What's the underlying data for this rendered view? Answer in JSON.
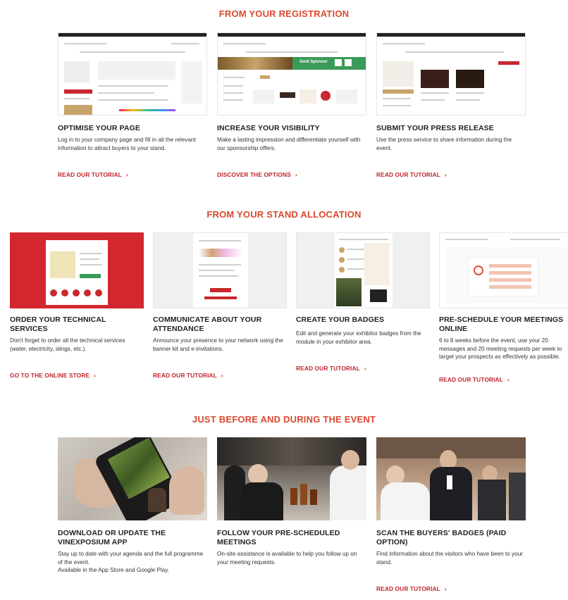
{
  "sections": [
    {
      "title": "FROM YOUR REGISTRATION"
    },
    {
      "title": "FROM YOUR STAND ALLOCATION"
    },
    {
      "title": "JUST BEFORE AND DURING THE EVENT"
    }
  ],
  "registration": [
    {
      "title": "OPTIMISE YOUR PAGE",
      "desc": "Log in to your company page and fill in all the relevant information to attract buyers to your stand.",
      "link": "READ OUR TUTORIAL"
    },
    {
      "title": "INCREASE YOUR VISIBILITY",
      "desc": "Make a lasting impression and differentiate yourself with our sponsorship offers.",
      "link": "DISCOVER THE OPTIONS"
    },
    {
      "title": "SUBMIT YOUR PRESS RELEASE",
      "desc": "Use the press service to share information during the event.",
      "link": "READ OUR TUTORIAL"
    }
  ],
  "stand": [
    {
      "title": "ORDER YOUR TECHNICAL SERVICES",
      "desc": "Don't forget to order all the technical services (water, electricity, slings, etc.).",
      "link": "GO TO THE ONLINE STORE"
    },
    {
      "title": "COMMUNICATE ABOUT YOUR ATTENDANCE",
      "desc": "Announce your presence to your network using the banner kit and e-invitations.",
      "link": "READ OUR TUTORIAL"
    },
    {
      "title": "CREATE YOUR BADGES",
      "desc": "Edit and generate your exhibitor badges from the module in your exhibitor area.",
      "link": "READ OUR TUTORIAL"
    },
    {
      "title": "PRE-SCHEDULE YOUR MEETINGS ONLINE",
      "desc": "6 to 8 weeks before the event, use your 20 messages and 20 meeting requests per week to target your prospects as effectively as possible.",
      "link": "READ OUR TUTORIAL"
    }
  ],
  "event": [
    {
      "title": "DOWNLOAD OR UPDATE THE VINEXPOSIUM APP",
      "desc": "Stay up to date with your agenda and the full programme of the event.",
      "desc2": "Available in the App Store and Google Play.",
      "link": ""
    },
    {
      "title": "FOLLOW YOUR PRE-SCHEDULED MEETINGS",
      "desc": "On-site assistance is available to help you follow up on your meeting requests.",
      "desc2": "",
      "link": ""
    },
    {
      "title": "SCAN THE BUYERS' BADGES (PAID OPTION)",
      "desc": "Find information about the visitors who have been to your stand.",
      "desc2": "",
      "link": "READ OUR TUTORIAL"
    }
  ],
  "mockups": {
    "sponsor_banner": "Gold Sponsor"
  },
  "colors": {
    "accent_orange": "#d9492f",
    "link_red": "#c0262d",
    "red_panel": "#d3272f"
  }
}
